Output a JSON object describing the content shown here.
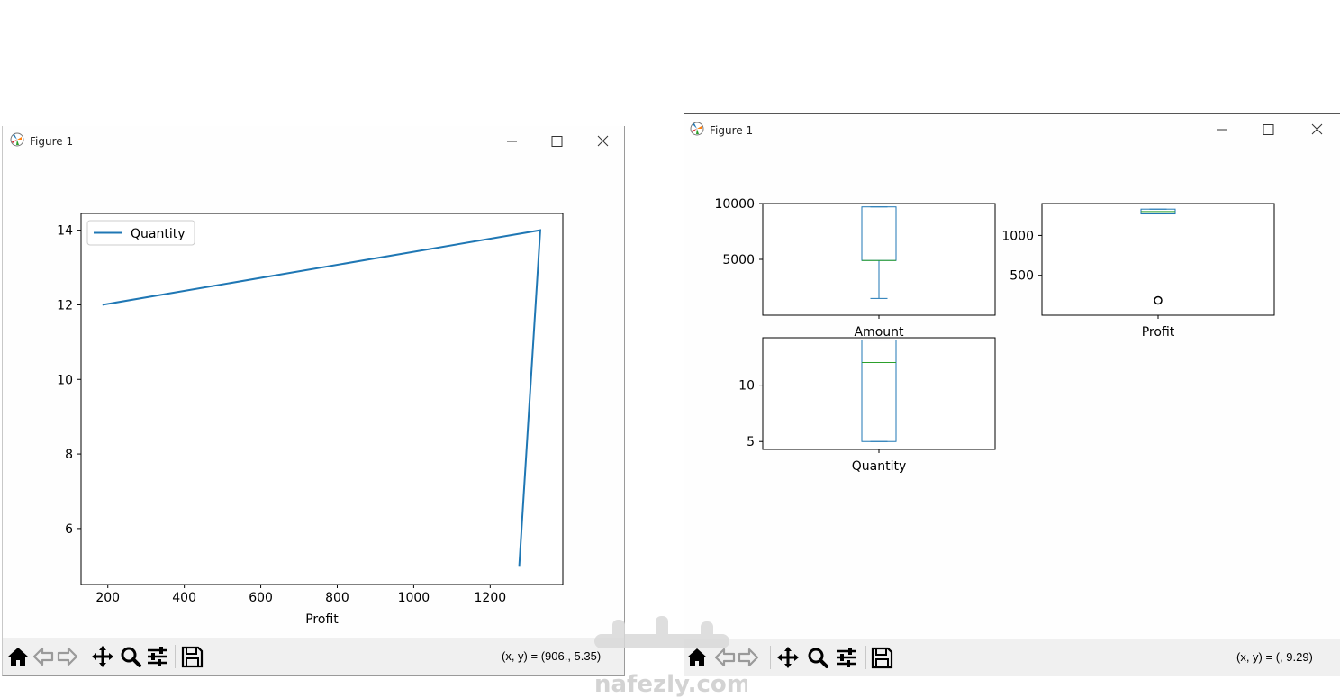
{
  "window1": {
    "title": "Figure 1",
    "coords": "(x, y) = (906., 5.35)"
  },
  "window2": {
    "title": "Figure 1",
    "coords": "(x, y) = (, 9.29)"
  },
  "watermark": {
    "text": "nafezly.com"
  },
  "colors": {
    "series": "#1f77b4",
    "median": "#2ca02c",
    "toolbar": "#f0f0f0"
  },
  "toolbar_icons": [
    "home-icon",
    "back-arrow-icon",
    "forward-arrow-icon",
    "pan-move-icon",
    "zoom-magnifier-icon",
    "configure-subplots-icon",
    "save-floppy-icon"
  ],
  "chart_data": [
    {
      "type": "line",
      "xlabel": "Profit",
      "ylabel": "",
      "x": [
        186,
        1331,
        1276
      ],
      "series": [
        {
          "name": "Quantity",
          "values": [
            12,
            14,
            5
          ]
        }
      ],
      "xlim": [
        130,
        1390
      ],
      "ylim": [
        4.5,
        14.45
      ],
      "xticks": [
        200,
        400,
        600,
        800,
        1000,
        1200
      ],
      "yticks": [
        6,
        8,
        10,
        12,
        14
      ],
      "legend": "top-left",
      "grid": false
    },
    {
      "type": "box",
      "xlabel": "Amount",
      "ylim": [
        0,
        10000
      ],
      "yticks": [
        5000,
        10000
      ],
      "stats": {
        "whisker_low": 1500,
        "q1": 4900,
        "median": 4900,
        "q3": 9700,
        "whisker_high": 9700,
        "outliers": []
      }
    },
    {
      "type": "box",
      "xlabel": "Profit",
      "ylim": [
        0,
        1400
      ],
      "yticks": [
        500,
        1000
      ],
      "stats": {
        "whisker_low": 1270,
        "q1": 1270,
        "median": 1300,
        "q3": 1330,
        "whisker_high": 1330,
        "outliers": [
          186
        ]
      }
    },
    {
      "type": "box",
      "xlabel": "Quantity",
      "ylim": [
        4.3,
        14.2
      ],
      "yticks": [
        5,
        10
      ],
      "stats": {
        "whisker_low": 5,
        "q1": 5,
        "median": 12,
        "q3": 14,
        "whisker_high": 14,
        "outliers": []
      }
    }
  ]
}
